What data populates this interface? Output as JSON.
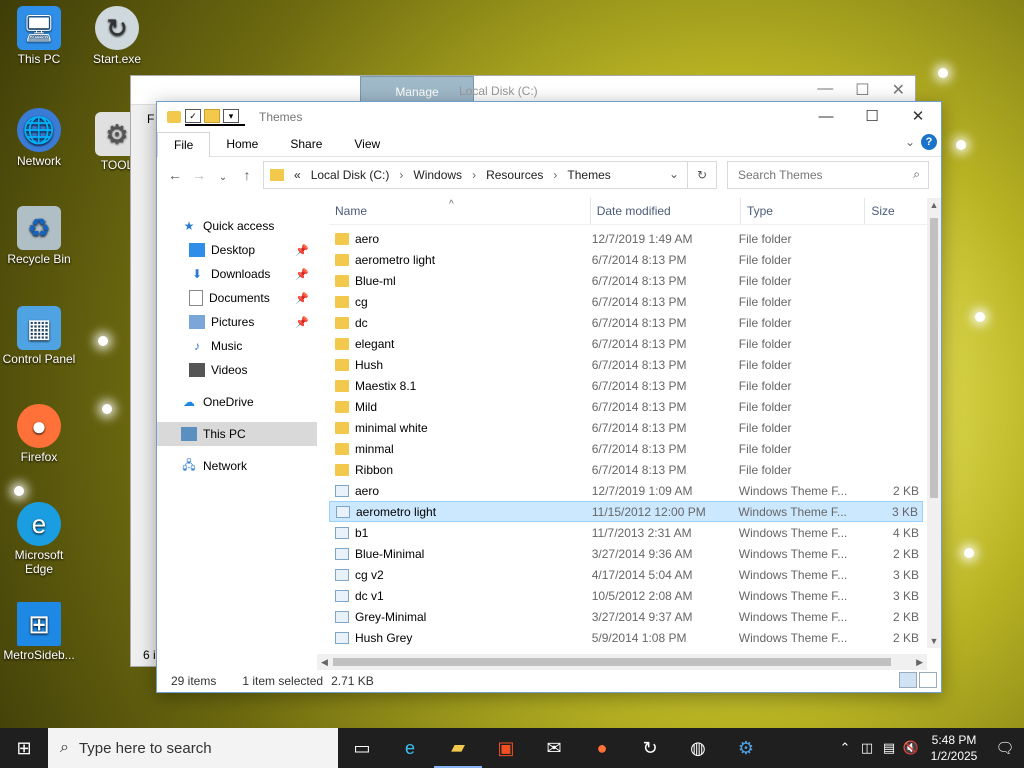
{
  "desktop": {
    "icons": [
      {
        "label": "This PC"
      },
      {
        "label": "Start.exe"
      },
      {
        "label": "Network"
      },
      {
        "label": "TOOL"
      },
      {
        "label": "Recycle Bin"
      },
      {
        "label": "Control Panel"
      },
      {
        "label": "Firefox"
      },
      {
        "label": "Microsoft Edge"
      },
      {
        "label": "MetroSideb..."
      }
    ]
  },
  "back_window": {
    "manage_tab": "Manage",
    "title": "Local Disk (C:)",
    "ribbon_partial": "F",
    "status_partial": "6 i"
  },
  "window": {
    "title": "Themes",
    "ribbon": {
      "tabs": [
        "File",
        "Home",
        "Share",
        "View"
      ]
    },
    "address": {
      "overflow": "«",
      "crumbs": [
        "Local Disk (C:)",
        "Windows",
        "Resources",
        "Themes"
      ]
    },
    "search": {
      "placeholder": "Search Themes"
    },
    "nav": {
      "quick_access": "Quick access",
      "items": [
        {
          "label": "Desktop"
        },
        {
          "label": "Downloads"
        },
        {
          "label": "Documents"
        },
        {
          "label": "Pictures"
        },
        {
          "label": "Music"
        },
        {
          "label": "Videos"
        }
      ],
      "onedrive": "OneDrive",
      "this_pc": "This PC",
      "network": "Network"
    },
    "columns": {
      "name": "Name",
      "date": "Date modified",
      "type": "Type",
      "size": "Size"
    },
    "files": [
      {
        "name": "aero",
        "date": "12/7/2019 1:49 AM",
        "type": "File folder",
        "size": "",
        "kind": "folder"
      },
      {
        "name": "aerometro light",
        "date": "6/7/2014 8:13 PM",
        "type": "File folder",
        "size": "",
        "kind": "folder"
      },
      {
        "name": "Blue-ml",
        "date": "6/7/2014 8:13 PM",
        "type": "File folder",
        "size": "",
        "kind": "folder"
      },
      {
        "name": "cg",
        "date": "6/7/2014 8:13 PM",
        "type": "File folder",
        "size": "",
        "kind": "folder"
      },
      {
        "name": "dc",
        "date": "6/7/2014 8:13 PM",
        "type": "File folder",
        "size": "",
        "kind": "folder"
      },
      {
        "name": "elegant",
        "date": "6/7/2014 8:13 PM",
        "type": "File folder",
        "size": "",
        "kind": "folder"
      },
      {
        "name": "Hush",
        "date": "6/7/2014 8:13 PM",
        "type": "File folder",
        "size": "",
        "kind": "folder"
      },
      {
        "name": "Maestix 8.1",
        "date": "6/7/2014 8:13 PM",
        "type": "File folder",
        "size": "",
        "kind": "folder"
      },
      {
        "name": "Mild",
        "date": "6/7/2014 8:13 PM",
        "type": "File folder",
        "size": "",
        "kind": "folder"
      },
      {
        "name": "minimal white",
        "date": "6/7/2014 8:13 PM",
        "type": "File folder",
        "size": "",
        "kind": "folder"
      },
      {
        "name": "minmal",
        "date": "6/7/2014 8:13 PM",
        "type": "File folder",
        "size": "",
        "kind": "folder"
      },
      {
        "name": "Ribbon",
        "date": "6/7/2014 8:13 PM",
        "type": "File folder",
        "size": "",
        "kind": "folder"
      },
      {
        "name": "aero",
        "date": "12/7/2019 1:09 AM",
        "type": "Windows Theme F...",
        "size": "2 KB",
        "kind": "theme"
      },
      {
        "name": "aerometro light",
        "date": "11/15/2012 12:00 PM",
        "type": "Windows Theme F...",
        "size": "3 KB",
        "kind": "theme",
        "selected": true
      },
      {
        "name": "b1",
        "date": "11/7/2013 2:31 AM",
        "type": "Windows Theme F...",
        "size": "4 KB",
        "kind": "theme"
      },
      {
        "name": "Blue-Minimal",
        "date": "3/27/2014 9:36 AM",
        "type": "Windows Theme F...",
        "size": "2 KB",
        "kind": "theme"
      },
      {
        "name": "cg v2",
        "date": "4/17/2014 5:04 AM",
        "type": "Windows Theme F...",
        "size": "3 KB",
        "kind": "theme"
      },
      {
        "name": "dc v1",
        "date": "10/5/2012 2:08 AM",
        "type": "Windows Theme F...",
        "size": "3 KB",
        "kind": "theme"
      },
      {
        "name": "Grey-Minimal",
        "date": "3/27/2014 9:37 AM",
        "type": "Windows Theme F...",
        "size": "2 KB",
        "kind": "theme"
      },
      {
        "name": "Hush Grey",
        "date": "5/9/2014 1:08 PM",
        "type": "Windows Theme F...",
        "size": "2 KB",
        "kind": "theme"
      }
    ],
    "status": {
      "count": "29 items",
      "selection": "1 item selected",
      "size": "2.71 KB"
    }
  },
  "taskbar": {
    "search_placeholder": "Type here to search",
    "time": "5:48 PM",
    "date": "1/2/2025"
  },
  "colors": {
    "selection": "#cce8ff",
    "accent": "#1a73c9",
    "taskbar": "#1f1f1f"
  }
}
